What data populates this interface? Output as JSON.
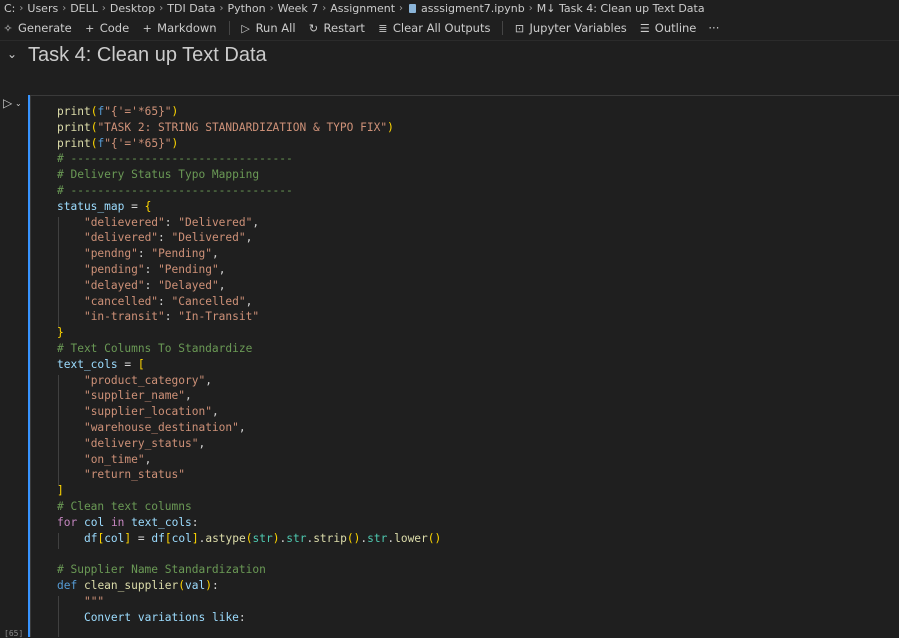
{
  "breadcrumb": [
    "C:",
    "Users",
    "DELL",
    "Desktop",
    "TDI Data",
    "Python",
    "Week 7",
    "Assignment",
    "asssigment7.ipynb",
    "M↓ Task 4: Clean up Text Data"
  ],
  "toolbar": {
    "generate": "Generate",
    "code": "Code",
    "markdown": "Markdown",
    "run_all": "Run All",
    "restart": "Restart",
    "clear_all_outputs": "Clear All Outputs",
    "jupyter_variables": "Jupyter Variables",
    "outline": "Outline",
    "more": "···"
  },
  "markdown_cell": {
    "heading": "Task 4: Clean up Text Data"
  },
  "code_cell": {
    "execution_count": "[65]",
    "lines": [
      "print(f\"{'='*65}\")",
      "print(\"TASK 2: STRING STANDARDIZATION & TYPO FIX\")",
      "print(f\"{'='*65}\")",
      "# ---------------------------------",
      "# Delivery Status Typo Mapping",
      "# ---------------------------------",
      "status_map = {",
      "    \"delievered\": \"Delivered\",",
      "    \"delivered\": \"Delivered\",",
      "    \"pendng\": \"Pending\",",
      "    \"pending\": \"Pending\",",
      "    \"delayed\": \"Delayed\",",
      "    \"cancelled\": \"Cancelled\",",
      "    \"in-transit\": \"In-Transit\"",
      "}",
      "# Text Columns To Standardize",
      "text_cols = [",
      "    \"product_category\",",
      "    \"supplier_name\",",
      "    \"supplier_location\",",
      "    \"warehouse_destination\",",
      "    \"delivery_status\",",
      "    \"on_time\",",
      "    \"return_status\"",
      "]",
      "# Clean text columns",
      "for col in text_cols:",
      "    df[col] = df[col].astype(str).str.strip().str.lower()",
      "",
      "# Supplier Name Standardization",
      "def clean_supplier(val):",
      "    \"\"\"",
      "    Convert variations like:"
    ]
  }
}
